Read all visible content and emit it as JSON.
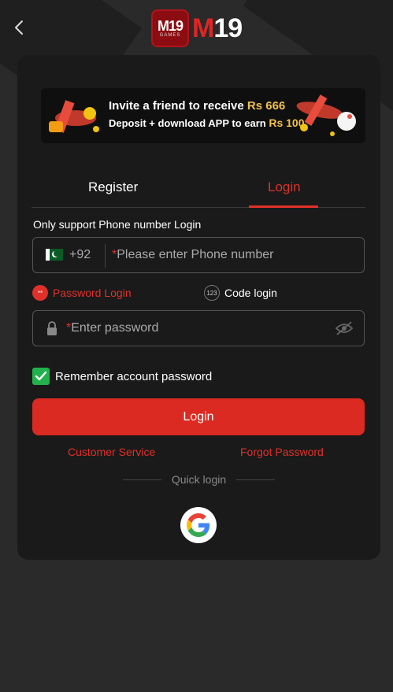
{
  "header": {
    "logo_badge_text": "M19",
    "logo_badge_sub": "GAMES",
    "logo_text_m": "M",
    "logo_text_rest": "19"
  },
  "banner": {
    "line1": "Invite a friend to receive",
    "line1_amount": "Rs 666",
    "line2": "Deposit + download APP to earn",
    "line2_amount": "Rs 100"
  },
  "tabs": [
    {
      "label": "Register",
      "active": false
    },
    {
      "label": "Login",
      "active": true
    }
  ],
  "hint": "Only support Phone number Login",
  "phone": {
    "country_code": "+92",
    "required_mark": "*",
    "placeholder": "Please enter Phone number"
  },
  "login_modes": {
    "password_label": "Password Login",
    "password_icon_text": "**",
    "code_label": "Code login",
    "code_icon_text": "123"
  },
  "password": {
    "required_mark": "*",
    "placeholder": "Enter password"
  },
  "remember_label": "Remember account password",
  "remember_checked": true,
  "login_button": "Login",
  "links": {
    "customer_service": "Customer Service",
    "forgot_password": "Forgot Password"
  },
  "quick_login_label": "Quick login",
  "colors": {
    "accent": "#e0302a",
    "button": "#db2a21",
    "check": "#22b14c",
    "card": "#1a1a1a",
    "background": "#2a2a2a"
  }
}
